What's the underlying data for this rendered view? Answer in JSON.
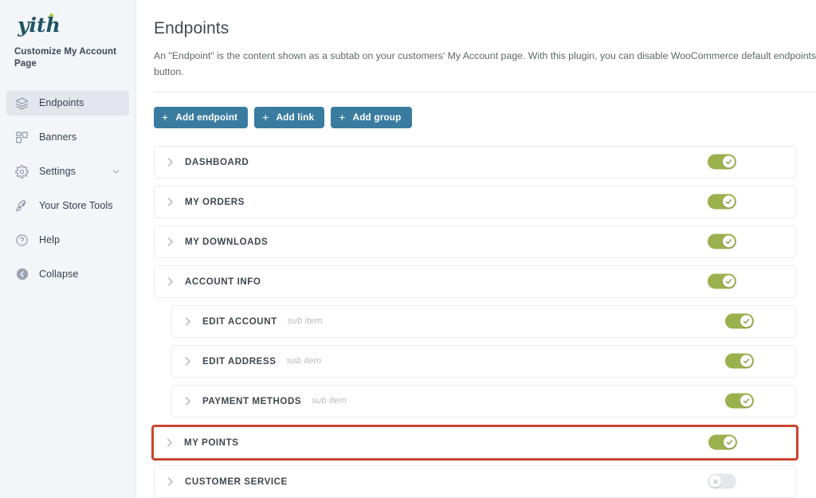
{
  "sidebar": {
    "logo_text": "yith",
    "sub_brand": "Customize My Account Page",
    "items": [
      {
        "label": "Endpoints",
        "icon": "layers-icon",
        "active": true,
        "chevron": false
      },
      {
        "label": "Banners",
        "icon": "banners-grid-icon",
        "active": false,
        "chevron": false
      },
      {
        "label": "Settings",
        "icon": "gear-icon",
        "active": false,
        "chevron": true
      },
      {
        "label": "Your Store Tools",
        "icon": "rocket-icon",
        "active": false,
        "chevron": false
      },
      {
        "label": "Help",
        "icon": "question-circle-icon",
        "active": false,
        "chevron": false
      },
      {
        "label": "Collapse",
        "icon": "collapse-arrow-icon",
        "active": false,
        "chevron": false
      }
    ]
  },
  "header": {
    "title": "Endpoints",
    "description": "An \"Endpoint\" is the content shown as a subtab on your customers' My Account page. With this plugin, you can disable WooCommerce default endpoints (Dashboard, Orders, etc.), edit the add new endpoints using the dedicated button."
  },
  "toolbar": {
    "buttons": [
      {
        "label": "Add endpoint",
        "icon": "plus-icon"
      },
      {
        "label": "Add link",
        "icon": "plus-icon"
      },
      {
        "label": "Add group",
        "icon": "plus-icon"
      }
    ],
    "button_color": "#3a7ca0"
  },
  "endpoints": {
    "toggle_on_color": "#9bb14e",
    "toggle_off_color": "#e4e7ec",
    "highlight_color": "#cb4530",
    "rows": [
      {
        "label": "DASHBOARD",
        "sublabel": "",
        "enabled": true,
        "sub": false,
        "highlighted": false
      },
      {
        "label": "MY ORDERS",
        "sublabel": "",
        "enabled": true,
        "sub": false,
        "highlighted": false
      },
      {
        "label": "MY DOWNLOADS",
        "sublabel": "",
        "enabled": true,
        "sub": false,
        "highlighted": false
      },
      {
        "label": "ACCOUNT INFO",
        "sublabel": "",
        "enabled": true,
        "sub": false,
        "highlighted": false
      },
      {
        "label": "EDIT ACCOUNT",
        "sublabel": "sub item",
        "enabled": true,
        "sub": true,
        "highlighted": false
      },
      {
        "label": "EDIT ADDRESS",
        "sublabel": "sub item",
        "enabled": true,
        "sub": true,
        "highlighted": false
      },
      {
        "label": "PAYMENT METHODS",
        "sublabel": "sub item",
        "enabled": true,
        "sub": true,
        "highlighted": false
      },
      {
        "label": "MY POINTS",
        "sublabel": "",
        "enabled": true,
        "sub": false,
        "highlighted": true
      },
      {
        "label": "CUSTOMER SERVICE",
        "sublabel": "",
        "enabled": false,
        "sub": false,
        "highlighted": false
      }
    ]
  }
}
